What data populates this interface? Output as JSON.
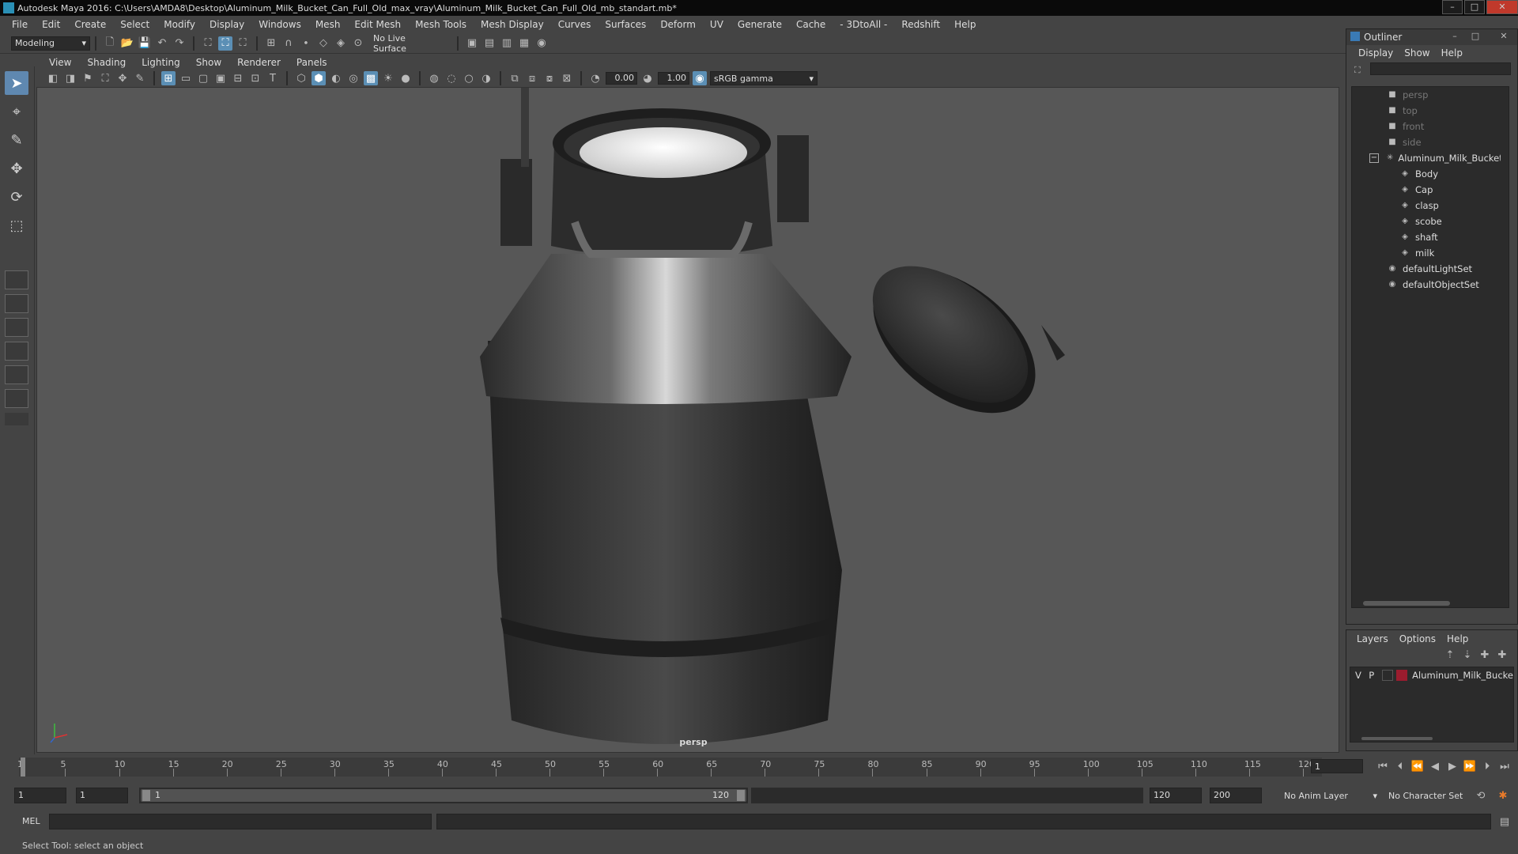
{
  "window": {
    "title": "Autodesk Maya 2016: C:\\Users\\AMDA8\\Desktop\\Aluminum_Milk_Bucket_Can_Full_Old_max_vray\\Aluminum_Milk_Bucket_Can_Full_Old_mb_standart.mb*"
  },
  "menubar": [
    "File",
    "Edit",
    "Create",
    "Select",
    "Modify",
    "Display",
    "Windows",
    "Mesh",
    "Edit Mesh",
    "Mesh Tools",
    "Mesh Display",
    "Curves",
    "Surfaces",
    "Deform",
    "UV",
    "Generate",
    "Cache",
    "- 3DtoAll -",
    "Redshift",
    "Help"
  ],
  "shelf": {
    "mode": "Modeling",
    "live_surface": "No Live Surface"
  },
  "viewport": {
    "menu": [
      "View",
      "Shading",
      "Lighting",
      "Show",
      "Renderer",
      "Panels"
    ],
    "exposure": "0.00",
    "gamma": "1.00",
    "color_space": "sRGB gamma",
    "camera": "persp"
  },
  "outliner": {
    "title": "Outliner",
    "menu": [
      "Display",
      "Show",
      "Help"
    ],
    "items": [
      {
        "label": "persp",
        "icon": "camera-icon",
        "dim": true,
        "indent": 1
      },
      {
        "label": "top",
        "icon": "camera-icon",
        "dim": true,
        "indent": 1
      },
      {
        "label": "front",
        "icon": "camera-icon",
        "dim": true,
        "indent": 1
      },
      {
        "label": "side",
        "icon": "camera-icon",
        "dim": true,
        "indent": 1
      },
      {
        "label": "Aluminum_Milk_Bucket_C",
        "icon": "group-icon",
        "dim": false,
        "indent": 1
      },
      {
        "label": "Body",
        "icon": "mesh-icon",
        "dim": false,
        "indent": 2
      },
      {
        "label": "Cap",
        "icon": "mesh-icon",
        "dim": false,
        "indent": 2
      },
      {
        "label": "clasp",
        "icon": "mesh-icon",
        "dim": false,
        "indent": 2
      },
      {
        "label": "scobe",
        "icon": "mesh-icon",
        "dim": false,
        "indent": 2
      },
      {
        "label": "shaft",
        "icon": "mesh-icon",
        "dim": false,
        "indent": 2
      },
      {
        "label": "milk",
        "icon": "mesh-icon",
        "dim": false,
        "indent": 2
      },
      {
        "label": "defaultLightSet",
        "icon": "set-icon",
        "dim": false,
        "indent": 1
      },
      {
        "label": "defaultObjectSet",
        "icon": "set-icon",
        "dim": false,
        "indent": 1
      }
    ]
  },
  "layers": {
    "menu": [
      "Layers",
      "Options",
      "Help"
    ],
    "row": {
      "v": "V",
      "p": "P",
      "name": "Aluminum_Milk_Bucke",
      "color": "#9b1c2e"
    }
  },
  "timeline": {
    "ticks": [
      "1",
      "5",
      "10",
      "15",
      "20",
      "25",
      "30",
      "35",
      "40",
      "45",
      "50",
      "55",
      "60",
      "65",
      "70",
      "75",
      "80",
      "85",
      "90",
      "95",
      "100",
      "105",
      "110",
      "115",
      "120"
    ],
    "current_frame": "1"
  },
  "range": {
    "start": "1",
    "playback_start": "1",
    "range_start_label": "1",
    "range_end_label": "120",
    "playback_end": "120",
    "end": "200",
    "anim_layer": "No Anim Layer",
    "character_set": "No Character Set"
  },
  "cmdline": {
    "label": "MEL"
  },
  "status": {
    "text": "Select Tool: select an object"
  },
  "colors": {
    "accent": "#5b8fb5",
    "layer": "#9b1c2e"
  }
}
